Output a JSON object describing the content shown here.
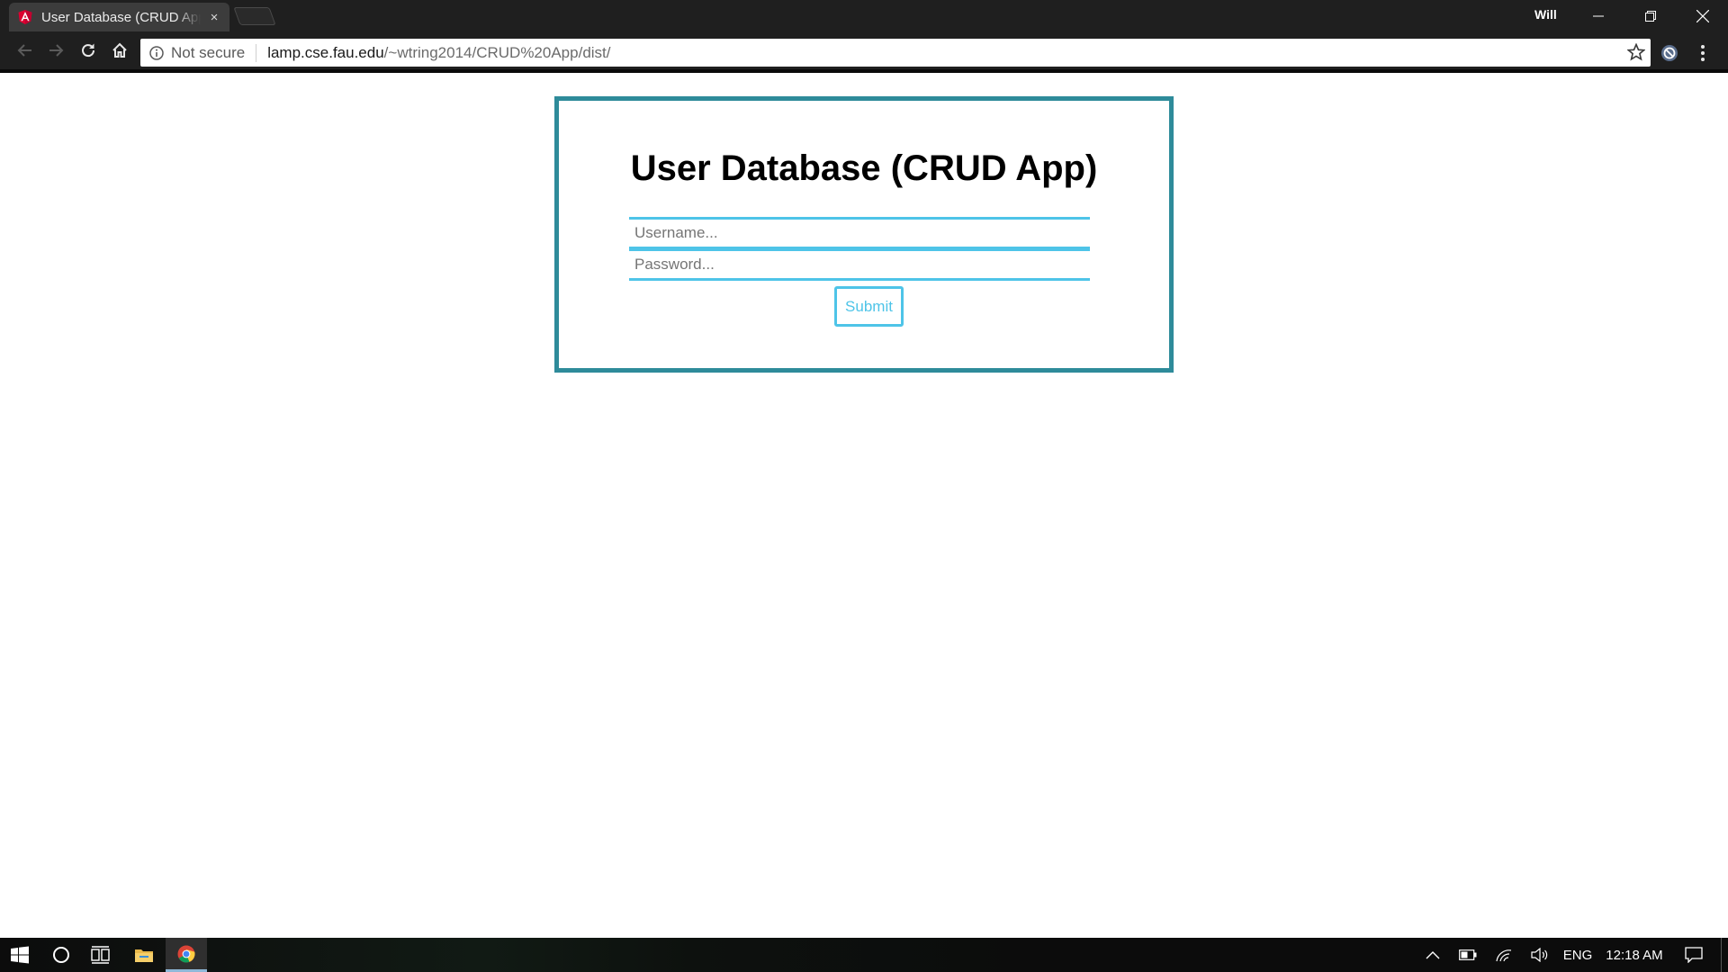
{
  "browser": {
    "tab": {
      "title": "User Database (CRUD App)",
      "close_glyph": "×"
    },
    "profile_name": "Will",
    "omnibox": {
      "security_status": "Not secure",
      "url_host": "lamp.cse.fau.edu",
      "url_path": "/~wtring2014/CRUD%20App/dist/"
    }
  },
  "page": {
    "title": "User Database (CRUD App)",
    "username_placeholder": "Username...",
    "password_placeholder": "Password...",
    "submit_label": "Submit"
  },
  "taskbar": {
    "language": "ENG",
    "time": "12:18 AM"
  },
  "colors": {
    "card_border": "#2e8b9a",
    "input_accent": "#4ec4e8",
    "chrome_dark": "#1f1f1f",
    "angular_red": "#dd0031"
  },
  "icons": [
    "angular-favicon",
    "back-icon",
    "forward-icon",
    "reload-icon",
    "home-icon",
    "info-icon",
    "star-icon",
    "extension-icon",
    "menu-icon",
    "minimize-icon",
    "restore-icon",
    "close-icon",
    "windows-start-icon",
    "cortana-icon",
    "task-view-icon",
    "file-explorer-icon",
    "chrome-icon",
    "chevron-up-icon",
    "battery-icon",
    "wifi-icon",
    "volume-icon",
    "notification-icon"
  ]
}
